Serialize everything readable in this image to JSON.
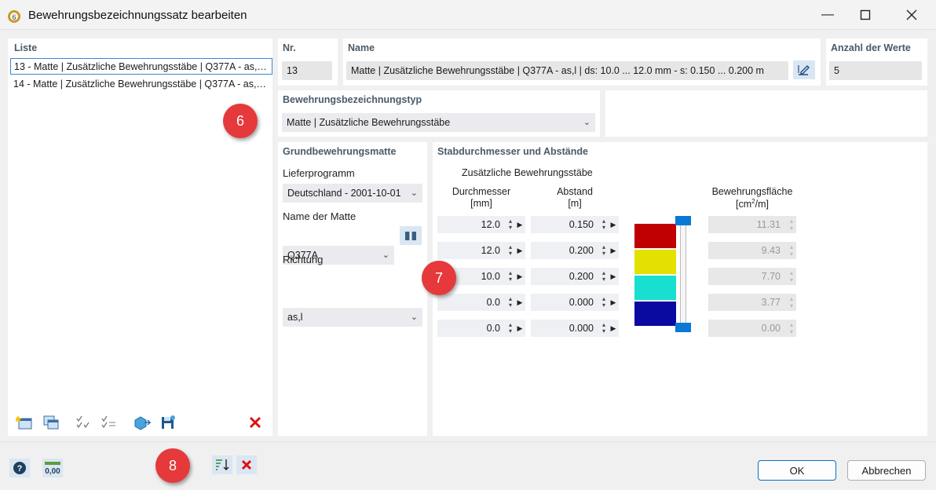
{
  "window": {
    "title": "Bewehrungsbezeichnungssatz bearbeiten"
  },
  "list": {
    "header": "Liste",
    "items": [
      "13 - Matte | Zusätzliche Bewehrungsstäbe | Q377A - as,…",
      "14 - Matte | Zusätzliche Bewehrungsstäbe | Q377A - as,…"
    ]
  },
  "nr": {
    "header": "Nr.",
    "value": "13"
  },
  "name": {
    "header": "Name",
    "value": "Matte | Zusätzliche Bewehrungsstäbe | Q377A - as,l | ds: 10.0 ... 12.0 mm - s: 0.150 ... 0.200 m"
  },
  "count": {
    "header": "Anzahl der Werte",
    "value": "5"
  },
  "type": {
    "header": "Bewehrungsbezeichnungstyp",
    "value": "Matte | Zusätzliche Bewehrungsstäbe"
  },
  "base": {
    "header": "Grundbewehrungsmatte",
    "program_label": "Lieferprogramm",
    "program_value": "Deutschland - 2001-10-01",
    "mat_label": "Name der Matte",
    "mat_value": "Q377A",
    "dir_label": "Richtung",
    "dir_value": "as,l"
  },
  "bars": {
    "header": "Stabdurchmesser und Abstände",
    "subheader": "Zusätzliche Bewehrungsstäbe",
    "col_d": "Durchmesser",
    "col_d_unit": "[mm]",
    "col_s": "Abstand",
    "col_s_unit": "[m]",
    "col_a": "Bewehrungsfläche",
    "col_a_unit_pre": "[cm",
    "col_a_unit_sup": "2",
    "col_a_unit_post": "/m]",
    "rows": [
      {
        "d": "12.0",
        "s": "0.150",
        "a": "11.31"
      },
      {
        "d": "12.0",
        "s": "0.200",
        "a": "9.43"
      },
      {
        "d": "10.0",
        "s": "0.200",
        "a": "7.70"
      },
      {
        "d": "0.0",
        "s": "0.000",
        "a": "3.77"
      },
      {
        "d": "0.0",
        "s": "0.000",
        "a": "0.00"
      }
    ],
    "colors": [
      "#c00000",
      "#e4e000",
      "#18e0d0",
      "#0a0aa0"
    ]
  },
  "badges": {
    "b6": "6",
    "b7": "7",
    "b8": "8"
  },
  "buttons": {
    "ok": "OK",
    "cancel": "Abbrechen"
  }
}
